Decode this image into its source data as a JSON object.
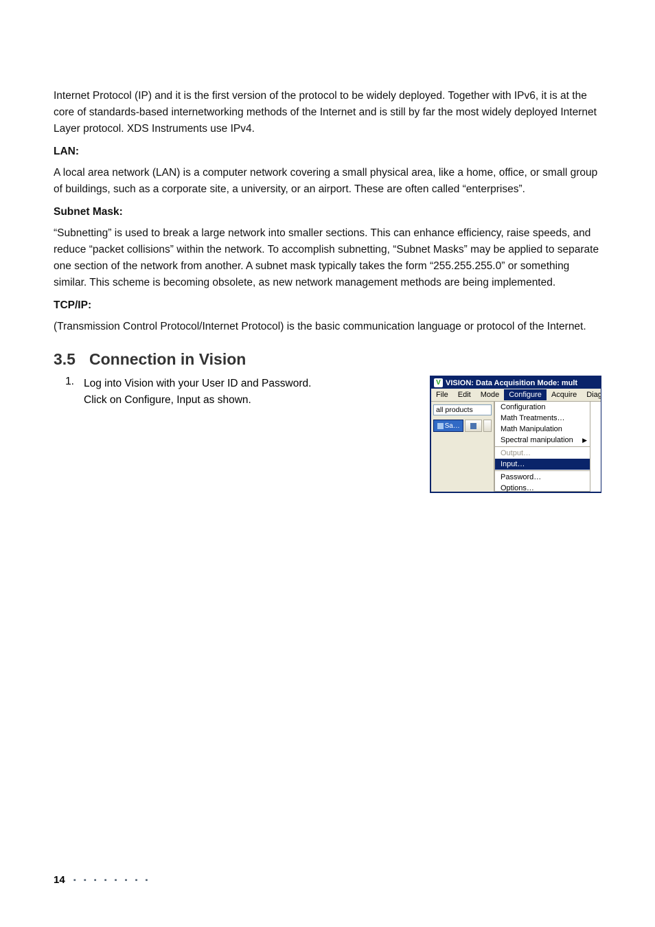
{
  "p_ipv4": "Internet Protocol (IP) and it is the first version of the protocol to be widely deployed. Together with IPv6, it is at the core of standards-based internetworking methods of the Internet and is still by far the most widely deployed Internet Layer protocol. XDS Instruments use IPv4.",
  "h_lan": "LAN:",
  "p_lan": "A local area network (LAN) is a computer network covering a small physical area, like a home, office, or small group of buildings, such as a corporate site, a university, or an airport. These are often called “enterprises”.",
  "h_subnet": "Subnet Mask:",
  "p_subnet": "“Subnetting” is used to break a large network into smaller sections. This can enhance efficiency, raise speeds, and reduce “packet collisions” within the network. To accomplish subnetting, “Subnet Masks” may be applied to separate one section of the network from another. A subnet mask typically takes the form “255.255.255.0” or something similar. This scheme is becoming obsolete, as new network management methods are being implemented.",
  "h_tcpip": "TCP/IP:",
  "p_tcpip": "(Transmission Control Protocol/Internet Protocol) is the basic communication language or protocol of the Internet.",
  "section_num": "3.5",
  "section_title": "Connection in Vision",
  "step1_num": "1.",
  "step1_line1": "Log into Vision with your User ID and Password.",
  "step1_line2": "Click on Configure, Input as shown.",
  "app": {
    "title": "VISION: Data Acquisition Mode: mult",
    "menu": {
      "file": "File",
      "edit": "Edit",
      "mode": "Mode",
      "configure": "Configure",
      "acquire": "Acquire",
      "diagnos": "Diagnos"
    },
    "left_input": "all products",
    "left_btn": "Sa…",
    "dd": {
      "configuration": "Configuration",
      "math_treatments": "Math Treatments…",
      "math_manipulation": "Math Manipulation",
      "spectral_manipulation": "Spectral manipulation",
      "output": "Output…",
      "input": "Input…",
      "password": "Password…",
      "options": "Options…"
    }
  },
  "footer": {
    "page": "14",
    "dots": "▪ ▪ ▪ ▪ ▪ ▪ ▪ ▪"
  },
  "title_icon_glyph": "V"
}
